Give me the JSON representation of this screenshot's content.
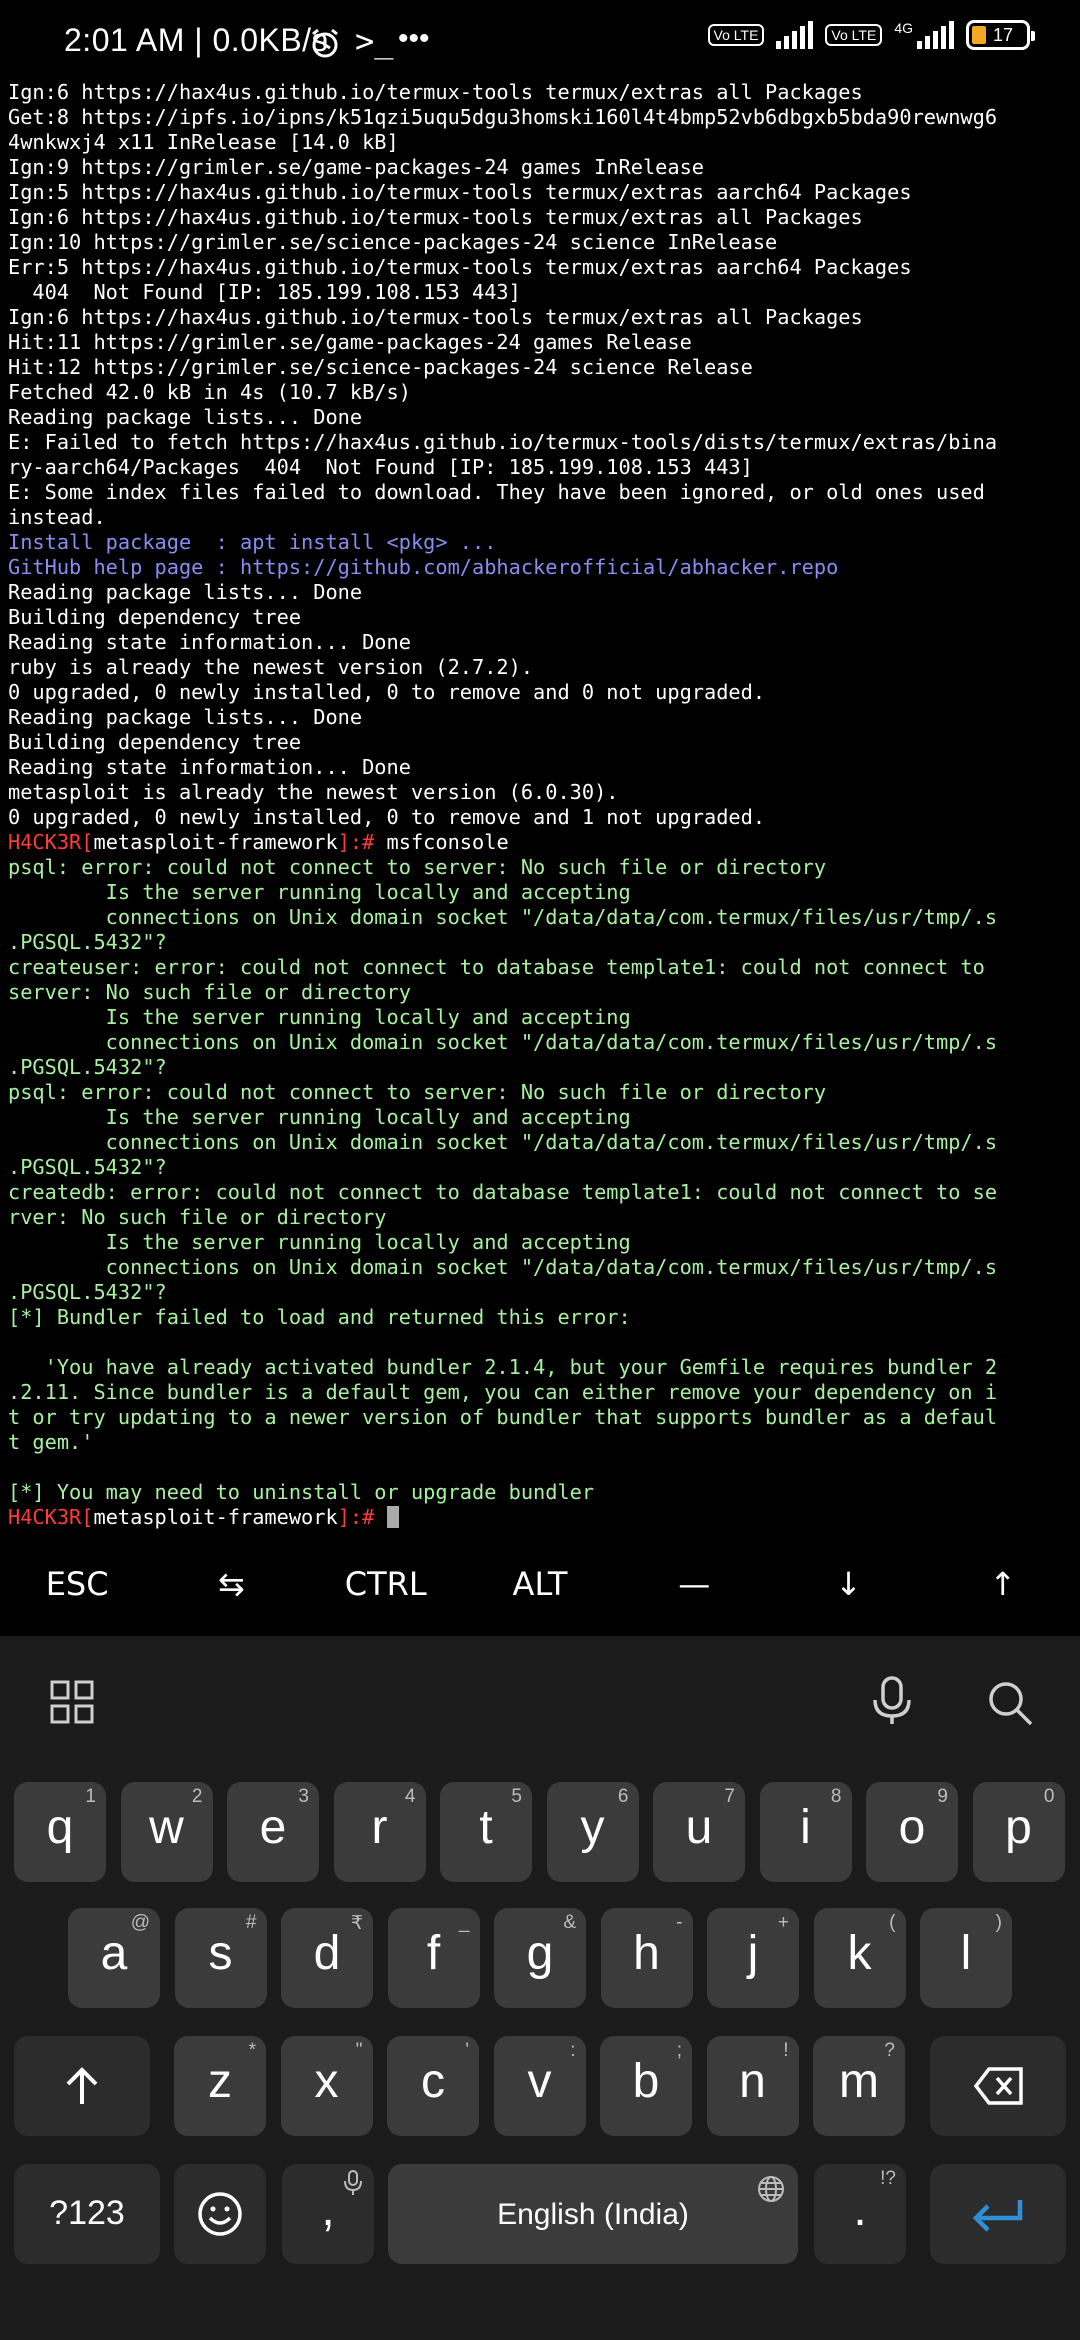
{
  "status_bar": {
    "time": "2:01 AM | 0.0KB/s",
    "volte_label": "Vo LTE",
    "network_4g": "4G",
    "battery_level": "17"
  },
  "terminal_lines": [
    {
      "text": "Ign:6 https://hax4us.github.io/termux-tools termux/extras all Packages",
      "color": "white"
    },
    {
      "text": "Get:8 https://ipfs.io/ipns/k51qzi5uqu5dgu3homski160l4t4bmp52vb6dbgxb5bda90rewnwg6",
      "color": "white"
    },
    {
      "text": "4wnkwxj4 x11 InRelease [14.0 kB]",
      "color": "white"
    },
    {
      "text": "Ign:9 https://grimler.se/game-packages-24 games InRelease",
      "color": "white"
    },
    {
      "text": "Ign:5 https://hax4us.github.io/termux-tools termux/extras aarch64 Packages",
      "color": "white"
    },
    {
      "text": "Ign:6 https://hax4us.github.io/termux-tools termux/extras all Packages",
      "color": "white"
    },
    {
      "text": "Ign:10 https://grimler.se/science-packages-24 science InRelease",
      "color": "white"
    },
    {
      "text": "Err:5 https://hax4us.github.io/termux-tools termux/extras aarch64 Packages",
      "color": "white"
    },
    {
      "text": "  404  Not Found [IP: 185.199.108.153 443]",
      "color": "white"
    },
    {
      "text": "Ign:6 https://hax4us.github.io/termux-tools termux/extras all Packages",
      "color": "white"
    },
    {
      "text": "Hit:11 https://grimler.se/game-packages-24 games Release",
      "color": "white"
    },
    {
      "text": "Hit:12 https://grimler.se/science-packages-24 science Release",
      "color": "white"
    },
    {
      "text": "Fetched 42.0 kB in 4s (10.7 kB/s)",
      "color": "white"
    },
    {
      "text": "Reading package lists... Done",
      "color": "white"
    },
    {
      "text": "E: Failed to fetch https://hax4us.github.io/termux-tools/dists/termux/extras/bina",
      "color": "white"
    },
    {
      "text": "ry-aarch64/Packages  404  Not Found [IP: 185.199.108.153 443]",
      "color": "white"
    },
    {
      "text": "E: Some index files failed to download. They have been ignored, or old ones used",
      "color": "white"
    },
    {
      "text": "instead.",
      "color": "white"
    },
    {
      "text": "Install package  : apt install <pkg> ...",
      "color": "blue"
    },
    {
      "text": "GitHub help page : https://github.com/abhackerofficial/abhacker.repo",
      "color": "blue"
    },
    {
      "text": "Reading package lists... Done",
      "color": "white"
    },
    {
      "text": "Building dependency tree",
      "color": "white"
    },
    {
      "text": "Reading state information... Done",
      "color": "white"
    },
    {
      "text": "ruby is already the newest version (2.7.2).",
      "color": "white"
    },
    {
      "text": "0 upgraded, 0 newly installed, 0 to remove and 0 not upgraded.",
      "color": "white"
    },
    {
      "text": "Reading package lists... Done",
      "color": "white"
    },
    {
      "text": "Building dependency tree",
      "color": "white"
    },
    {
      "text": "Reading state information... Done",
      "color": "white"
    },
    {
      "text": "metasploit is already the newest version (6.0.30).",
      "color": "white"
    },
    {
      "text": "0 upgraded, 0 newly installed, 0 to remove and 1 not upgraded.",
      "color": "white"
    },
    {
      "prompt": true,
      "user": "H4CK3R",
      "dir": "metasploit-framework",
      "cmd": "msfconsole"
    },
    {
      "text": "psql: error: could not connect to server: No such file or directory",
      "color": "green"
    },
    {
      "text": "        Is the server running locally and accepting",
      "color": "green"
    },
    {
      "text": "        connections on Unix domain socket \"/data/data/com.termux/files/usr/tmp/.s",
      "color": "green"
    },
    {
      "text": ".PGSQL.5432\"?",
      "color": "green"
    },
    {
      "text": "createuser: error: could not connect to database template1: could not connect to",
      "color": "green"
    },
    {
      "text": "server: No such file or directory",
      "color": "green"
    },
    {
      "text": "        Is the server running locally and accepting",
      "color": "green"
    },
    {
      "text": "        connections on Unix domain socket \"/data/data/com.termux/files/usr/tmp/.s",
      "color": "green"
    },
    {
      "text": ".PGSQL.5432\"?",
      "color": "green"
    },
    {
      "text": "psql: error: could not connect to server: No such file or directory",
      "color": "green"
    },
    {
      "text": "        Is the server running locally and accepting",
      "color": "green"
    },
    {
      "text": "        connections on Unix domain socket \"/data/data/com.termux/files/usr/tmp/.s",
      "color": "green"
    },
    {
      "text": ".PGSQL.5432\"?",
      "color": "green"
    },
    {
      "text": "createdb: error: could not connect to database template1: could not connect to se",
      "color": "green"
    },
    {
      "text": "rver: No such file or directory",
      "color": "green"
    },
    {
      "text": "        Is the server running locally and accepting",
      "color": "green"
    },
    {
      "text": "        connections on Unix domain socket \"/data/data/com.termux/files/usr/tmp/.s",
      "color": "green"
    },
    {
      "text": ".PGSQL.5432\"?",
      "color": "green"
    },
    {
      "text": "[*] Bundler failed to load and returned this error:",
      "color": "green"
    },
    {
      "text": "",
      "color": "green"
    },
    {
      "text": "   'You have already activated bundler 2.1.4, but your Gemfile requires bundler 2",
      "color": "green"
    },
    {
      "text": ".2.11. Since bundler is a default gem, you can either remove your dependency on i",
      "color": "green"
    },
    {
      "text": "t or try updating to a newer version of bundler that supports bundler as a defaul",
      "color": "green"
    },
    {
      "text": "t gem.'",
      "color": "green"
    },
    {
      "text": "",
      "color": "green"
    },
    {
      "text": "[*] You may need to uninstall or upgrade bundler",
      "color": "green"
    },
    {
      "prompt": true,
      "user": "H4CK3R",
      "dir": "metasploit-framework",
      "cmd": "",
      "cursor": true
    }
  ],
  "extra_keys": [
    "ESC",
    "⇆",
    "CTRL",
    "ALT",
    "—",
    "↓",
    "↑"
  ],
  "keyboard": {
    "row1": [
      {
        "key": "q",
        "hint": "1"
      },
      {
        "key": "w",
        "hint": "2"
      },
      {
        "key": "e",
        "hint": "3"
      },
      {
        "key": "r",
        "hint": "4"
      },
      {
        "key": "t",
        "hint": "5"
      },
      {
        "key": "y",
        "hint": "6"
      },
      {
        "key": "u",
        "hint": "7"
      },
      {
        "key": "i",
        "hint": "8"
      },
      {
        "key": "o",
        "hint": "9"
      },
      {
        "key": "p",
        "hint": "0"
      }
    ],
    "row2": [
      {
        "key": "a",
        "hint": "@"
      },
      {
        "key": "s",
        "hint": "#"
      },
      {
        "key": "d",
        "hint": "₹"
      },
      {
        "key": "f",
        "hint": "_"
      },
      {
        "key": "g",
        "hint": "&"
      },
      {
        "key": "h",
        "hint": "-"
      },
      {
        "key": "j",
        "hint": "+"
      },
      {
        "key": "k",
        "hint": "("
      },
      {
        "key": "l",
        "hint": ")"
      }
    ],
    "row3": [
      {
        "key": "z",
        "hint": "*"
      },
      {
        "key": "x",
        "hint": "\""
      },
      {
        "key": "c",
        "hint": "'"
      },
      {
        "key": "v",
        "hint": ":"
      },
      {
        "key": "b",
        "hint": ";"
      },
      {
        "key": "n",
        "hint": "!"
      },
      {
        "key": "m",
        "hint": "?"
      }
    ],
    "symbols_label": "?123",
    "comma_label": ",",
    "space_label": "English (India)",
    "period_label": ".",
    "period_hint": "!?"
  }
}
